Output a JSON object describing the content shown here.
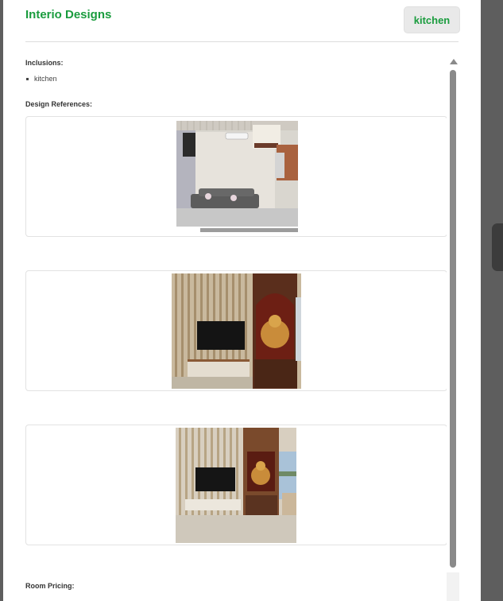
{
  "header": {
    "brand": "Interio Designs",
    "room_badge": "kitchen"
  },
  "inclusions": {
    "label": "Inclusions:",
    "items": [
      "kitchen"
    ]
  },
  "references": {
    "label": "Design References:",
    "images": [
      {
        "name": "living-room-render"
      },
      {
        "name": "tv-unit-mandir-render"
      },
      {
        "name": "tv-unit-mandir-window-render"
      }
    ]
  },
  "pricing": {
    "label": "Room Pricing:"
  }
}
